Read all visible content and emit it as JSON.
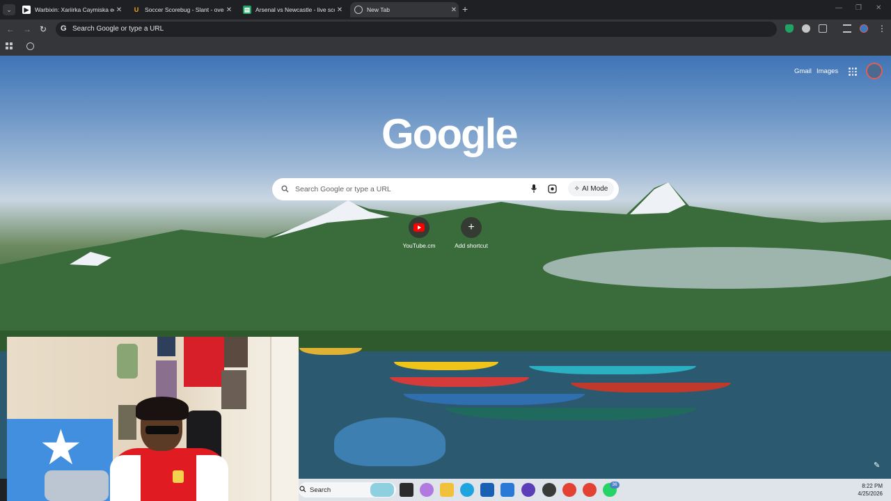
{
  "browser": {
    "tabs": [
      {
        "title": "Warbixin: Xariirka Caymiska ee",
        "favicon": "document-icon",
        "active": false
      },
      {
        "title": "Soccer Scorebug - Slant - overl",
        "favicon": "horseshoe-icon",
        "active": false
      },
      {
        "title": "Arsenal vs Newcastle - live scor",
        "favicon": "sheet-icon",
        "active": false
      },
      {
        "title": "New Tab",
        "favicon": "chrome-icon",
        "active": true
      }
    ],
    "omnibox": {
      "placeholder": "Search Google or type a URL"
    }
  },
  "ntp": {
    "top_links": {
      "gmail": "Gmail",
      "images": "Images"
    },
    "logo": "Google",
    "search": {
      "placeholder": "Search Google or type a URL",
      "ai_mode_label": "AI Mode"
    },
    "shortcuts": [
      {
        "label": "YouTube.cm",
        "icon": "youtube-icon"
      },
      {
        "label": "Add shortcut",
        "icon": "plus-icon"
      }
    ]
  },
  "taskbar": {
    "search_label": "Search",
    "time": "8:22 PM",
    "date": "4/25/2026",
    "badge": "36"
  },
  "colors": {
    "tabstrip": "#1f2023",
    "toolbar": "#35363a",
    "accent_red": "#d71f2a",
    "youtube_red": "#ff0000"
  }
}
